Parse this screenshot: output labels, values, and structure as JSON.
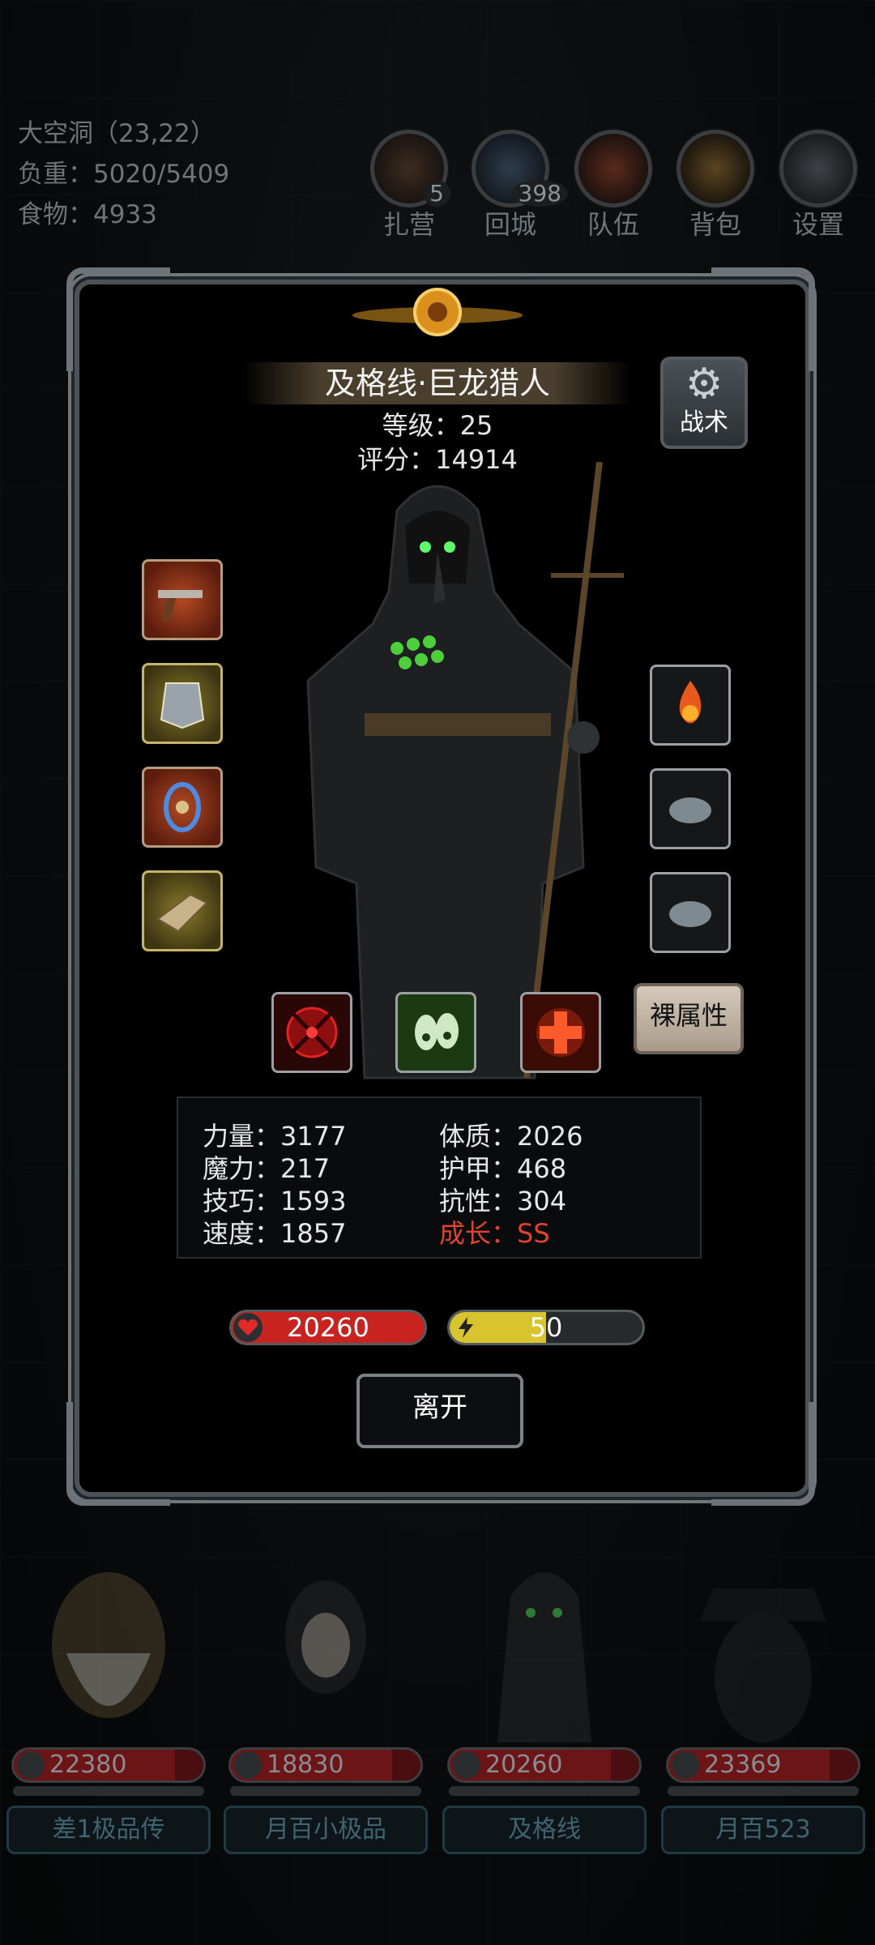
{
  "location": {
    "name": "大空洞（23,22）",
    "load": "负重：5020/5409",
    "food": "食物：4933"
  },
  "menu": [
    {
      "label": "扎营",
      "badge": "5",
      "icon": "campfire-icon"
    },
    {
      "label": "回城",
      "badge": "398",
      "icon": "portal-icon"
    },
    {
      "label": "队伍",
      "badge": "",
      "icon": "team-icon"
    },
    {
      "label": "背包",
      "badge": "",
      "icon": "backpack-icon"
    },
    {
      "label": "设置",
      "badge": "",
      "icon": "gear-icon"
    }
  ],
  "hero": {
    "name": "及格线·巨龙猎人",
    "level": "等级：25",
    "score": "评分：14914",
    "tactic_label": "战术",
    "naked_label": "裸属性"
  },
  "equipment_left": [
    {
      "icon": "pistol-icon",
      "style": "red"
    },
    {
      "icon": "armor-icon",
      "style": "gold"
    },
    {
      "icon": "amulet-icon",
      "style": "red"
    },
    {
      "icon": "gauntlet-icon",
      "style": "gold"
    }
  ],
  "equipment_right": [
    {
      "icon": "fire-orb-icon"
    },
    {
      "icon": "stone-icon"
    },
    {
      "icon": "stone-icon"
    }
  ],
  "skills": [
    {
      "icon": "crosshair-icon",
      "color": "#c21717"
    },
    {
      "icon": "poison-skull-icon",
      "color": "#6bd23a"
    },
    {
      "icon": "heal-cross-icon",
      "color": "#e0421b"
    }
  ],
  "stats": {
    "strength": "力量：3177",
    "magic": "魔力：217",
    "skill": "技巧：1593",
    "speed": "速度：1857",
    "constitution": "体质：2026",
    "armor": "护甲：468",
    "resistance": "抗性：304",
    "growth": "成长：SS"
  },
  "hp": {
    "value": "20260",
    "fraction": 1.0,
    "color": "#c9231f"
  },
  "energy": {
    "value": "50",
    "fraction": 0.5,
    "color": "#d8c42e"
  },
  "leave_label": "离开",
  "team": [
    {
      "hp": "22380",
      "tag": "差1极品传"
    },
    {
      "hp": "18830",
      "tag": "月百小极品"
    },
    {
      "hp": "20260",
      "tag": "及格线"
    },
    {
      "hp": "23369",
      "tag": "月百523"
    }
  ],
  "colors": {
    "growth_text": "#e0442f",
    "panel_border": "#6f777c"
  }
}
